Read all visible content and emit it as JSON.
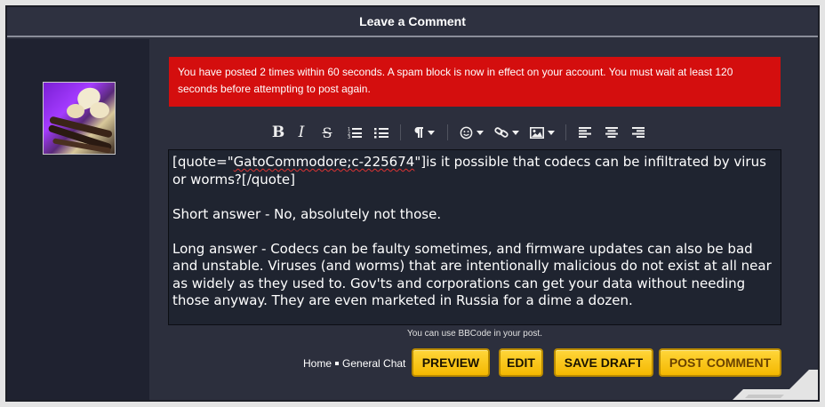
{
  "header": {
    "title": "Leave a Comment"
  },
  "alert": {
    "message": "You have posted 2 times within 60 seconds. A spam block is now in effect on your account. You must wait at least 120 seconds before attempting to post again.",
    "color": "#d40e0e"
  },
  "toolbar": {
    "bold": "B",
    "italic": "I",
    "strike": "S",
    "icons": [
      "bold-icon",
      "italic-icon",
      "strikethrough-icon",
      "ordered-list-icon",
      "unordered-list-icon",
      "paragraph-icon",
      "emoji-icon",
      "link-icon",
      "image-icon",
      "align-left-icon",
      "align-center-icon",
      "align-right-icon"
    ]
  },
  "editor": {
    "quote_prefix": "[quote=\"",
    "quote_user": "GatoCommodore;c-225674",
    "quote_rest": "\"]is it possible that codecs can be infiltrated by virus or worms?[/quote]",
    "short_answer": "Short answer - No, absolutely not those.",
    "long_answer": "Long answer - Codecs can be faulty sometimes, and firmware updates can also be bad and unstable. Viruses (and worms) that are intentionally malicious do not exist at all near as widely as they used to. Gov'ts and corporations can get your data without needing those anyway. They are even marketed in Russia for a dime a dozen."
  },
  "bbcode_note": "You can use BBCode in your post.",
  "breadcrumb": {
    "home": "Home",
    "category": "General Chat"
  },
  "buttons": {
    "preview": "PREVIEW",
    "edit": "EDIT",
    "save_draft": "SAVE DRAFT",
    "post_comment": "POST COMMENT",
    "color": "#f4b800"
  }
}
